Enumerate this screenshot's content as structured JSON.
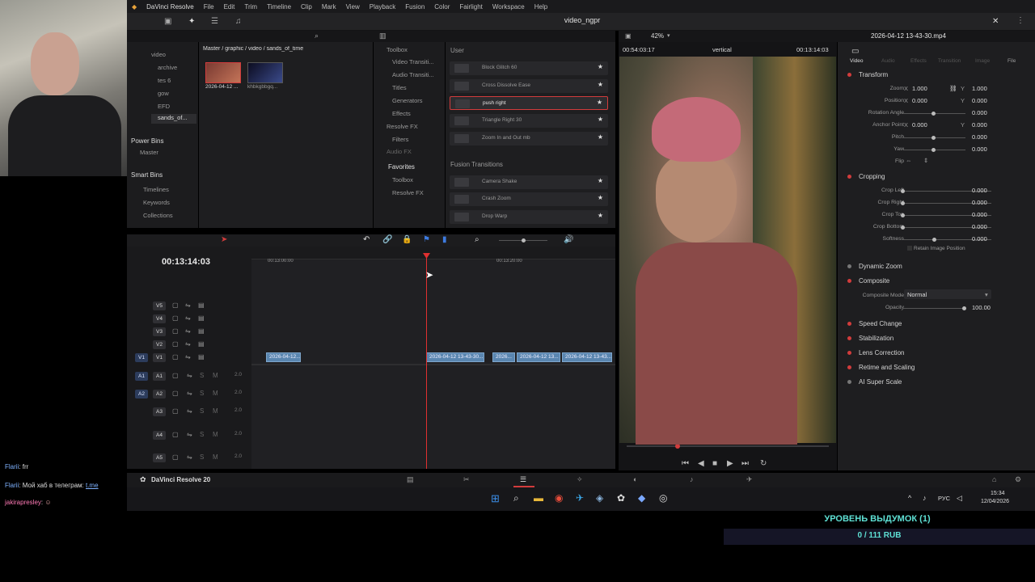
{
  "menu": {
    "app": "DaVinci Resolve",
    "items": [
      "File",
      "Edit",
      "Trim",
      "Timeline",
      "Clip",
      "Mark",
      "View",
      "Playback",
      "Fusion",
      "Color",
      "Fairlight",
      "Workspace",
      "Help"
    ]
  },
  "project_title": "video_ngpr",
  "viewer": {
    "zoom": "42%",
    "source_tc": "00:54:03:17",
    "mode": "vertical",
    "timecode": "00:13:14:03",
    "clip_name": "2026-04-12 13-43-30.mp4"
  },
  "media": {
    "path": "Master / graphic / video / sands_of_time",
    "bins": [
      "video",
      "archive",
      "tes 6",
      "gow",
      "EFD",
      "sands_of..."
    ],
    "power_bins": "Power Bins",
    "power_master": "Master",
    "smart_bins": "Smart Bins",
    "smart_items": [
      "Timelines",
      "Keywords",
      "Collections"
    ],
    "thumbs": [
      "2026-04-12 ...",
      "khbkgbbgq..."
    ]
  },
  "effects": {
    "tree": [
      "Toolbox",
      "Video Transiti...",
      "Audio Transiti...",
      "Titles",
      "Generators",
      "Effects",
      "Resolve FX",
      "Filters",
      "Audio FX"
    ],
    "favorites": "Favorites",
    "fav_items": [
      "Toolbox",
      "Resolve FX"
    ],
    "user_header": "User",
    "user_items": [
      "Block Glitch 60",
      "Cross Dissolve Ease",
      "push right",
      "Triangle Right 30",
      "Zoom In and Out mb"
    ],
    "fusion_header": "Fusion Transitions",
    "fusion_items": [
      "Camera Shake",
      "Crash Zoom",
      "Drop Warp"
    ]
  },
  "inspector": {
    "tabs": [
      "Video",
      "Audio",
      "Effects",
      "Transition",
      "Image",
      "File"
    ],
    "transform": "Transform",
    "zoom": {
      "label": "Zoom",
      "x": "1.000",
      "y": "1.000"
    },
    "position": {
      "label": "Position",
      "x": "0.000",
      "y": "0.000"
    },
    "rotation": {
      "label": "Rotation Angle",
      "v": "0.000"
    },
    "anchor": {
      "label": "Anchor Point",
      "x": "0.000",
      "y": "0.000"
    },
    "pitch": {
      "label": "Pitch",
      "v": "0.000"
    },
    "yaw": {
      "label": "Yaw",
      "v": "0.000"
    },
    "flip": "Flip",
    "cropping": "Cropping",
    "crop_left": {
      "label": "Crop Left",
      "v": "0.000"
    },
    "crop_right": {
      "label": "Crop Right",
      "v": "0.000"
    },
    "crop_top": {
      "label": "Crop Top",
      "v": "0.000"
    },
    "crop_bottom": {
      "label": "Crop Bottom",
      "v": "0.000"
    },
    "softness": {
      "label": "Softness",
      "v": "0.000"
    },
    "retain": "Retain Image Position",
    "dynamic_zoom": "Dynamic Zoom",
    "composite": "Composite",
    "composite_mode": {
      "label": "Composite Mode",
      "v": "Normal"
    },
    "opacity": {
      "label": "Opacity",
      "v": "100.00"
    },
    "sections": [
      "Speed Change",
      "Stabilization",
      "Lens Correction",
      "Retime and Scaling",
      "AI Super Scale"
    ]
  },
  "timeline": {
    "timecode": "00:13:14:03",
    "ruler": [
      "00:13:00:00",
      "00:13:20:00"
    ],
    "video_tracks": [
      "V5",
      "V4",
      "V3",
      "V2",
      "V1"
    ],
    "audio_tracks": [
      "A1",
      "A2",
      "A3",
      "A4",
      "A5"
    ],
    "audio_level": "2.0",
    "clips": [
      "2026-04-12...",
      "2026-04-12 13-43-30...",
      "2026...",
      "2026-04-12 13...",
      "2026-04-12 13-43..."
    ],
    "src_v": "V1",
    "src_a1": "A1",
    "src_a2": "A2"
  },
  "bottom": {
    "version": "DaVinci Resolve 20"
  },
  "taskbar": {
    "lang": "РУС",
    "time": "15:34",
    "date": "12/04/2026"
  },
  "chat": [
    {
      "user": "Flarii",
      "msg": "frr"
    },
    {
      "user": "Flarii",
      "msg": "Мой хаб в телеграм:",
      "link": "t.me"
    },
    {
      "user": "jakirapresley",
      "msg": ""
    }
  ],
  "donation": {
    "title": "УРОВЕНЬ ВЫДУМОК (1)",
    "amount": "0 / 111 RUB"
  },
  "colors": {
    "accent": "#d23c3c",
    "clip": "#5a86b0",
    "playhead": "#e03030"
  }
}
